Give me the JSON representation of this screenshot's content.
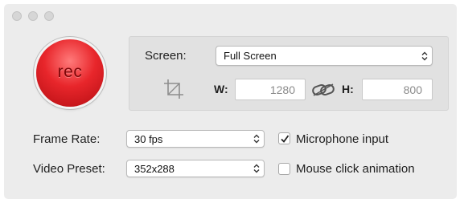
{
  "window": {
    "traffic_lights": [
      "close-button",
      "minimize-button",
      "zoom-button"
    ]
  },
  "record_button": {
    "label": "rec",
    "color": "#e8262b"
  },
  "capture": {
    "screen_label": "Screen:",
    "screen_value": "Full Screen",
    "crop_icon": "crop-icon",
    "width_label": "W:",
    "width_value": "1280",
    "link_icon": "link-chain-icon",
    "height_label": "H:",
    "height_value": "800"
  },
  "settings": {
    "frame_rate_label": "Frame Rate:",
    "frame_rate_value": "30 fps",
    "video_preset_label": "Video Preset:",
    "video_preset_value": "352x288",
    "microphone_label": "Microphone input",
    "microphone_checked": true,
    "mouse_click_label": "Mouse click animation",
    "mouse_click_checked": false
  }
}
